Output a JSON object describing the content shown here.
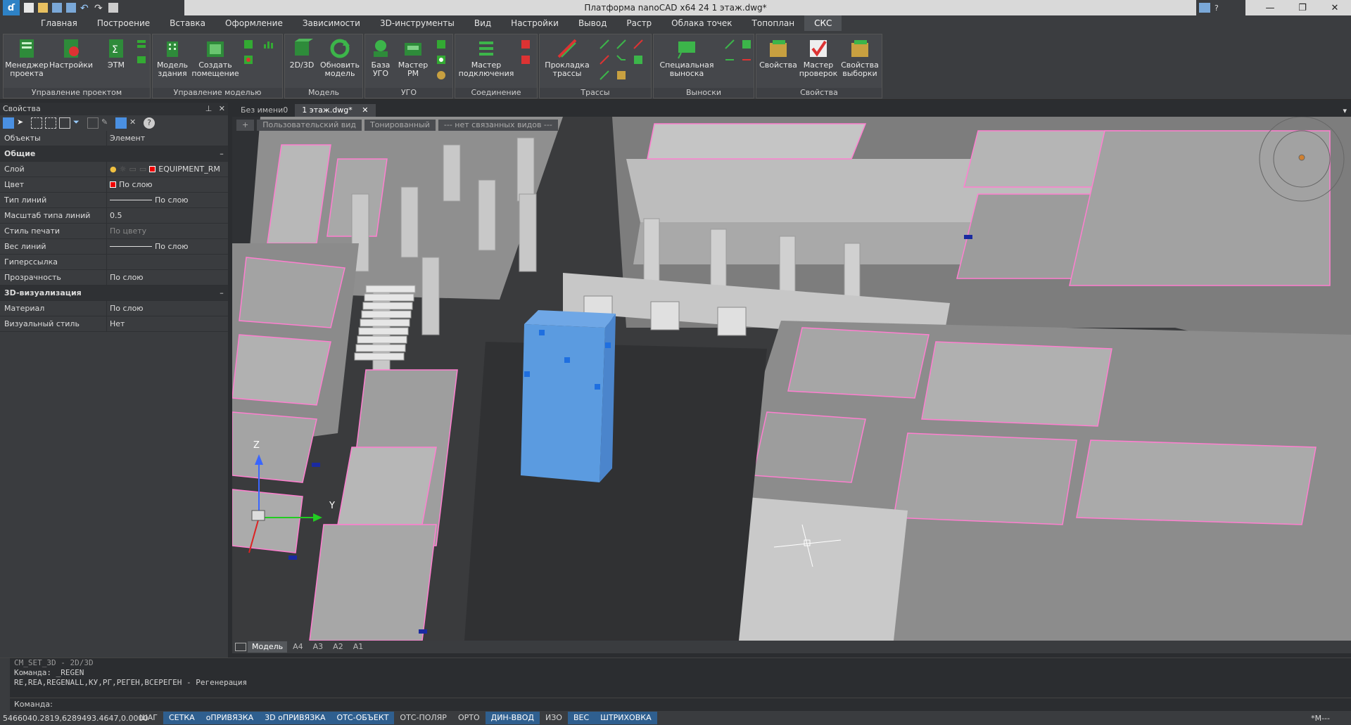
{
  "window": {
    "title": "Платформа nanoCAD x64 24 1 этаж.dwg*",
    "help_label": "?"
  },
  "ribbon_tabs": [
    "Главная",
    "Построение",
    "Вставка",
    "Оформление",
    "Зависимости",
    "3D-инструменты",
    "Вид",
    "Настройки",
    "Вывод",
    "Растр",
    "Облака точек",
    "Топоплан",
    "СКС"
  ],
  "ribbon_active_tab": "СКС",
  "ribbon": {
    "groups": [
      {
        "label": "Управление проектом",
        "buttons": [
          "Менеджер\nпроекта",
          "Настройки",
          "ЭТМ"
        ]
      },
      {
        "label": "Управление моделью",
        "buttons": [
          "Модель\nздания",
          "Создать\nпомещение"
        ]
      },
      {
        "label": "Модель",
        "buttons": [
          "2D/3D",
          "Обновить\nмодель"
        ]
      },
      {
        "label": "УГО",
        "buttons": [
          "База\nУГО",
          "Мастер\nРМ"
        ]
      },
      {
        "label": "Соединение",
        "buttons": [
          "Мастер\nподключения"
        ]
      },
      {
        "label": "Трассы",
        "buttons": [
          "Прокладка\nтрассы"
        ]
      },
      {
        "label": "Выноски",
        "buttons": [
          "Специальная\nвыноска"
        ]
      },
      {
        "label": "Свойства",
        "buttons": [
          "Свойства",
          "Мастер\nпроверок",
          "Свойства\nвыборки"
        ]
      }
    ]
  },
  "properties": {
    "panel_title": "Свойства",
    "header_key": "Объекты",
    "header_value": "Элемент",
    "sections": [
      {
        "title": "Общие",
        "rows": [
          {
            "k": "Слой",
            "v": "EQUIPMENT_RM"
          },
          {
            "k": "Цвет",
            "v": "По слою"
          },
          {
            "k": "Тип линий",
            "v": "По слою"
          },
          {
            "k": "Масштаб типа линий",
            "v": "0.5"
          },
          {
            "k": "Стиль печати",
            "v": "По цвету"
          },
          {
            "k": "Вес линий",
            "v": "По слою"
          },
          {
            "k": "Гиперссылка",
            "v": ""
          },
          {
            "k": "Прозрачность",
            "v": "По слою"
          }
        ]
      },
      {
        "title": "3D-визуализация",
        "rows": [
          {
            "k": "Материал",
            "v": "По слою"
          },
          {
            "k": "Визуальный стиль",
            "v": "Нет"
          }
        ]
      }
    ],
    "collapse_symbol": "–"
  },
  "doc_tabs": [
    "Без имени0",
    "1 этаж.dwg*"
  ],
  "viewport": {
    "labels": [
      "+",
      "Пользовательский вид",
      "Тонированный",
      "--- нет связанных видов ---"
    ],
    "axis_z": "Z",
    "axis_y": "Y"
  },
  "layout_tabs": [
    "Модель",
    "A4",
    "A3",
    "A2",
    "A1"
  ],
  "command_line": {
    "lines": [
      "CM_SET_3D - 2D/3D",
      "Команда: _REGEN",
      "RE,REA,REGENALL,КУ,РГ,РЕГЕН,ВСЕРЕГЕН - Регенерация"
    ],
    "prompt": "Команда:"
  },
  "statusbar": {
    "coords": "5466040.2819,6289493.4647,0.0000",
    "toggles": [
      {
        "label": "ШАГ",
        "on": false
      },
      {
        "label": "СЕТКА",
        "on": true
      },
      {
        "label": "оПРИВЯЗКА",
        "on": true
      },
      {
        "label": "3D оПРИВЯЗКА",
        "on": true
      },
      {
        "label": "ОТС-ОБЪЕКТ",
        "on": true
      },
      {
        "label": "ОТС-ПОЛЯР",
        "on": false
      },
      {
        "label": "ОРТО",
        "on": false
      },
      {
        "label": "ДИН-ВВОД",
        "on": true
      },
      {
        "label": "ИЗО",
        "on": false
      },
      {
        "label": "ВЕС",
        "on": true
      },
      {
        "label": "ШТРИХОВКА",
        "on": true
      }
    ],
    "right": "*М---"
  },
  "colors": {
    "selected_object": "#5b9be0",
    "wall": "#c8c8c8",
    "wall_outline": "#ff7fd0",
    "status_on": "#2f5f8f"
  }
}
